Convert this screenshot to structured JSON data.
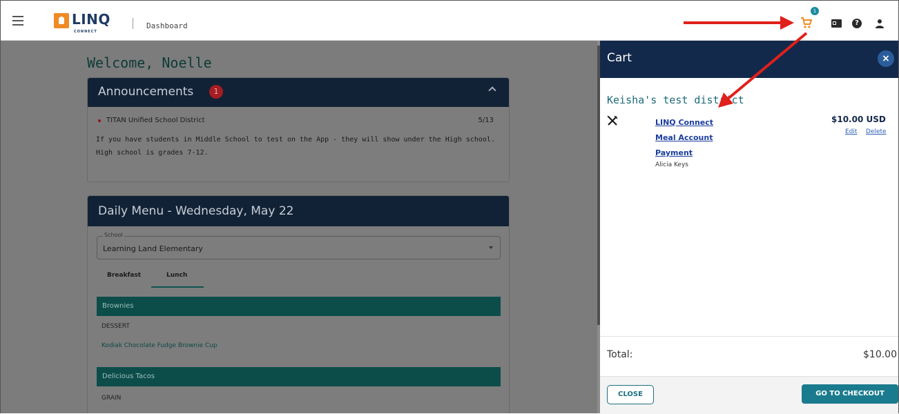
{
  "header": {
    "logo": "LINQ",
    "logo_sub": "CONNECT",
    "title": "Dashboard",
    "cart_count": "1",
    "help_glyph": "?"
  },
  "main": {
    "welcome": "Welcome, Noelle",
    "announcements": {
      "title": "Announcements",
      "count": "1",
      "district": "TITAN Unified School District",
      "date": "5/13",
      "body": "If you have students in Middle School to test on the App - they will show under the High school.  High school is grades 7-12."
    },
    "daily_menu": {
      "title": "Daily Menu - Wednesday, May 22",
      "school_label": "School",
      "school_value": "Learning Land Elementary",
      "tabs": [
        "Breakfast",
        "Lunch"
      ],
      "rows": [
        {
          "section": "Brownies",
          "category": "DESSERT",
          "item": "Kodiak Chocolate Fudge Brownie Cup"
        },
        {
          "section": "Delicious Tacos",
          "category": "GRAIN"
        }
      ]
    }
  },
  "cart": {
    "title": "Cart",
    "close_glyph": "×",
    "district": "Keisha's test district",
    "item": {
      "title_lines": [
        "LINQ Connect",
        "Meal Account",
        "Payment"
      ],
      "student": "Alicia Keys",
      "price": "$10.00 USD",
      "edit": "Edit",
      "delete": "Delete"
    },
    "total_label": "Total:",
    "total_value": "$10.00",
    "close_button": "CLOSE",
    "checkout_button": "GO TO CHECKOUT"
  },
  "colors": {
    "header_navy": "#13294b",
    "accent_teal": "#1b7b8e",
    "arrow_red": "#e0201b",
    "brand_orange": "#f08a24"
  }
}
